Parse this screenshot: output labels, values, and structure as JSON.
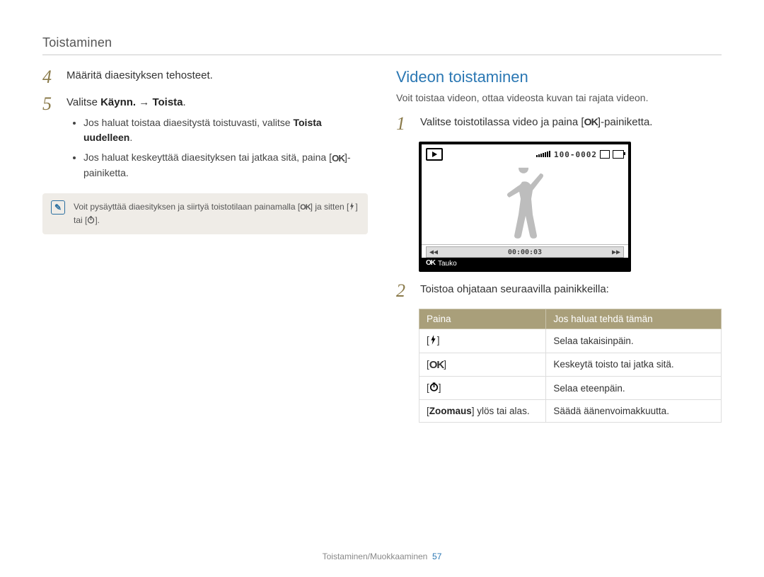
{
  "header": "Toistaminen",
  "left": {
    "step4": "Määritä diaesityksen tehosteet.",
    "step5_pre": "Valitse ",
    "step5_bold1": "Käynn.",
    "step5_arrow": " → ",
    "step5_bold2": "Toista",
    "step5_post": ".",
    "b1_pre": "Jos haluat toistaa diaesitystä toistuvasti, valitse ",
    "b1_bold": "Toista uudelleen",
    "b1_post": ".",
    "b2_pre": "Jos haluat keskeyttää diaesityksen tai jatkaa sitä, paina [",
    "b2_post": "]-painiketta.",
    "note_pre": "Voit pysäyttää diaesityksen ja siirtyä toistotilaan painamalla [",
    "note_mid": "] ja sitten [",
    "note_mid2": "] tai [",
    "note_post": "]."
  },
  "right": {
    "title": "Videon toistaminen",
    "intro": "Voit toistaa videon, ottaa videosta kuvan tai rajata videon.",
    "step1_pre": "Valitse toistotilassa video ja paina [",
    "step1_post": "]-painiketta.",
    "ss_counter": "100-0002",
    "ss_time": "00:00:03",
    "ss_pause": "Tauko",
    "step2": "Toistoa ohjataan seuraavilla painikkeilla:",
    "th1": "Paina",
    "th2": "Jos haluat tehdä tämän",
    "r1c2": "Selaa takaisinpäin.",
    "r2c2": "Keskeytä toisto tai jatka sitä.",
    "r3c2": "Selaa eteenpäin.",
    "r4c1_pre": "[",
    "r4c1_bold": "Zoomaus",
    "r4c1_post": "] ylös tai alas.",
    "r4c2": "Säädä äänenvoimakkuutta."
  },
  "footer": {
    "text": "Toistaminen/Muokkaaminen",
    "page": "57"
  }
}
